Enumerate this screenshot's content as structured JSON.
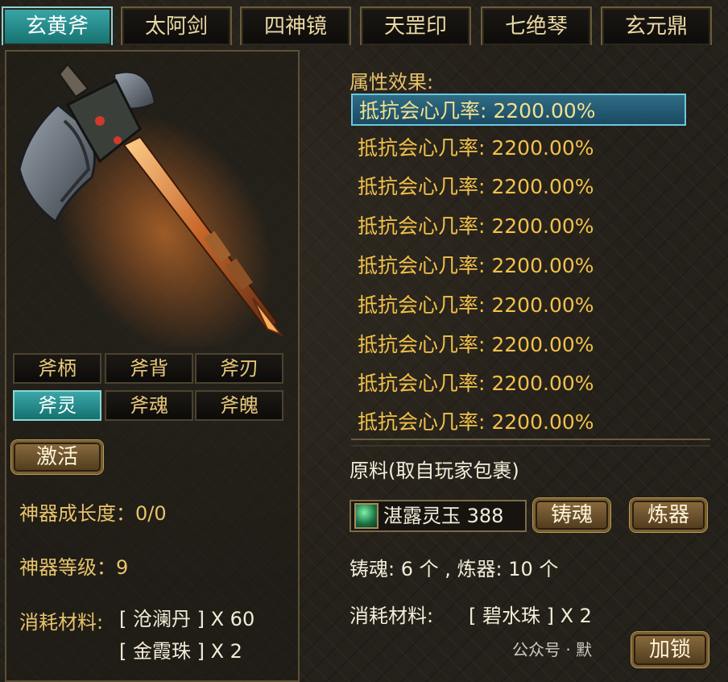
{
  "tabs": [
    "玄黄斧",
    "太阿剑",
    "四神镜",
    "天罡印",
    "七绝琴",
    "玄元鼎"
  ],
  "active_tab": 0,
  "sub_tabs": [
    "斧柄",
    "斧背",
    "斧刃",
    "斧灵",
    "斧魂",
    "斧魄"
  ],
  "active_sub_tab": 3,
  "left": {
    "activate_label": "激活",
    "growth_label": "神器成长度：",
    "growth_value": "0/0",
    "level_label": "神器等级：",
    "level_value": "9",
    "consume_label": "消耗材料:",
    "consume_items": [
      "[ 沧澜丹 ] X 60",
      "[ 金霞珠 ] X 2"
    ]
  },
  "right": {
    "attr_title": "属性效果:",
    "attributes": [
      "抵抗会心几率: 2200.00%",
      "抵抗会心几率: 2200.00%",
      "抵抗会心几率: 2200.00%",
      "抵抗会心几率: 2200.00%",
      "抵抗会心几率: 2200.00%",
      "抵抗会心几率: 2200.00%",
      "抵抗会心几率: 2200.00%",
      "抵抗会心几率: 2200.00%",
      "抵抗会心几率: 2200.00%"
    ],
    "selected_attr": 0,
    "materials_title": "原料(取自玩家包裹)",
    "material_slot": "湛露灵玉 388",
    "forge_soul_label": "铸魂",
    "refine_label": "炼器",
    "counts_text": "铸魂: 6 个 , 炼器: 10 个",
    "consume_label": "消耗材料:",
    "consume_item": "[ 碧水珠 ] X 2",
    "lock_label": "加锁"
  },
  "watermark": "公众号 · 默"
}
